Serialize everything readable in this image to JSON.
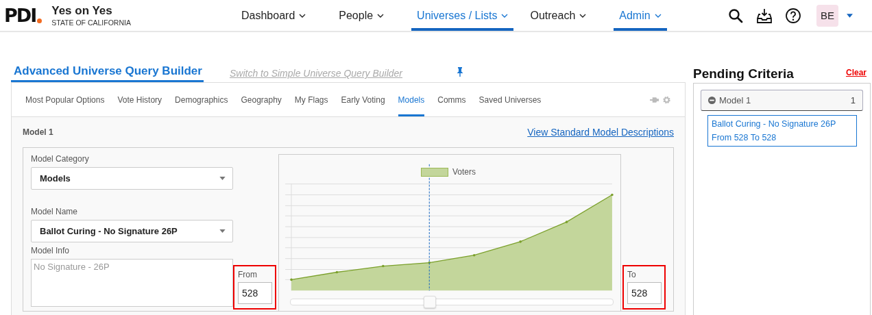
{
  "header": {
    "logo": "PDI",
    "org_name": "Yes on Yes",
    "org_sub": "STATE OF CALIFORNIA",
    "avatar": "BE",
    "nav": [
      {
        "label": "Dashboard",
        "selected": false
      },
      {
        "label": "People",
        "selected": false
      },
      {
        "label": "Universes / Lists",
        "selected": true
      },
      {
        "label": "Outreach",
        "selected": false
      },
      {
        "label": "Admin",
        "selected": true
      }
    ]
  },
  "builder": {
    "title": "Advanced Universe Query Builder",
    "switch_link": "Switch to Simple Universe Query Builder",
    "tabs": [
      {
        "label": "Most Popular Options",
        "selected": false
      },
      {
        "label": "Vote History",
        "selected": false
      },
      {
        "label": "Demographics",
        "selected": false
      },
      {
        "label": "Geography",
        "selected": false
      },
      {
        "label": "My Flags",
        "selected": false
      },
      {
        "label": "Early Voting",
        "selected": false
      },
      {
        "label": "Models",
        "selected": true
      },
      {
        "label": "Comms",
        "selected": false
      },
      {
        "label": "Saved Universes",
        "selected": false
      }
    ],
    "section_title": "Model 1",
    "descriptions_link": "View Standard Model Descriptions",
    "category": {
      "label": "Model Category",
      "value": "Models"
    },
    "name": {
      "label": "Model Name",
      "value": "Ballot Curing - No Signature 26P"
    },
    "info": {
      "label": "Model Info",
      "placeholder": "No Signature - 26P"
    },
    "from": {
      "label": "From",
      "value": "528"
    },
    "to": {
      "label": "To",
      "value": "528"
    },
    "chart": {
      "legend": "Voters"
    },
    "slider": {
      "level": 0.43
    }
  },
  "pending": {
    "title": "Pending Criteria",
    "clear": "Clear",
    "groups": [
      {
        "name": "Model 1",
        "count": "1",
        "lines": [
          "Ballot Curing - No Signature 26P",
          "From 528 To 528"
        ]
      }
    ]
  }
}
